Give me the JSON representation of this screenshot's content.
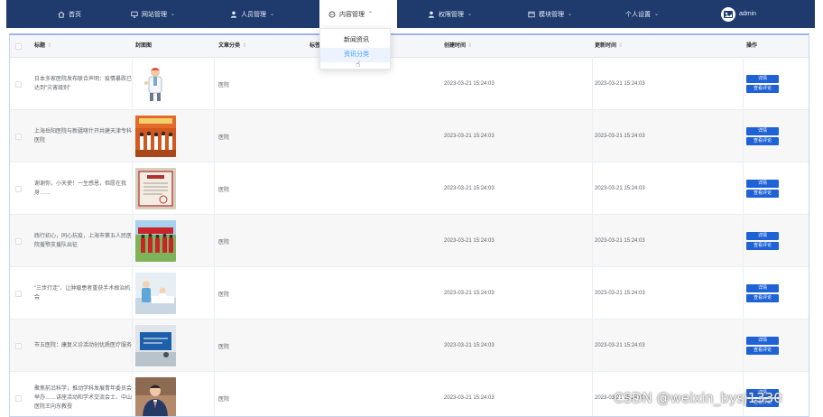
{
  "nav": {
    "items": [
      {
        "label": "首页",
        "icon": "home-icon"
      },
      {
        "label": "网站管理",
        "icon": "monitor-icon"
      },
      {
        "label": "人员管理",
        "icon": "user-icon"
      },
      {
        "label": "内容管理",
        "icon": "chat-icon",
        "active": true
      },
      {
        "label": "权限管理",
        "icon": "user-icon"
      },
      {
        "label": "模块管理",
        "icon": "window-icon"
      },
      {
        "label": "个人设置"
      }
    ],
    "user": {
      "name": "admin"
    }
  },
  "dropdown": {
    "items": [
      "新闻资讯",
      "资讯分类"
    ],
    "hovered_index": 1
  },
  "table": {
    "headers": {
      "title": "标题",
      "cover": "封面图",
      "category": "文章分类",
      "tags": "标签",
      "created": "创建时间",
      "updated": "更新时间",
      "actions": "操作"
    },
    "buttons": {
      "detail": "详情",
      "comments": "查看评论"
    },
    "rows": [
      {
        "title": "日本多家医院发布联合声明：疫情暴跌已达到\"灾害级别\"",
        "category": "医院",
        "created": "2023-03-21 15:24:03",
        "updated": "2023-03-21 15:24:03",
        "thumb": "doctor"
      },
      {
        "title": "上海岳阳医院与新疆喀什开共建天津专科医院",
        "category": "医院",
        "created": "2023-03-21 15:24:03",
        "updated": "2023-03-21 15:24:03",
        "thumb": "group"
      },
      {
        "title": "谢谢你，小天使！一生感恩，但愿在我身……",
        "category": "医院",
        "created": "2023-03-21 15:24:03",
        "updated": "2023-03-21 15:24:03",
        "thumb": "certificate"
      },
      {
        "title": "践行初心，同心抗疫，上海市第五人民医院援鄂支援队出征",
        "category": "医院",
        "created": "2023-03-21 15:24:03",
        "updated": "2023-03-21 15:24:03",
        "thumb": "banner"
      },
      {
        "title": "\"三步行走\"，让肿瘤患者重获手术根治机会",
        "category": "医院",
        "created": "2023-03-21 15:24:03",
        "updated": "2023-03-21 15:24:03",
        "thumb": "ward"
      },
      {
        "title": "市五医院：康复义诊活动创优质医疗服务",
        "category": "医院",
        "created": "2023-03-21 15:24:03",
        "updated": "2023-03-21 15:24:03",
        "thumb": "sign"
      },
      {
        "title": "聚焦前沿科学，推动学科发展青年委员会举办……讲座活动和学术交流会士、中山医院王向东教授",
        "category": "医院",
        "created": "2023-03-21 15:24:03",
        "updated": "2023-03-21 15:24:03",
        "thumb": "portrait"
      }
    ]
  },
  "watermark": "CSDN @weixin_bysj1330"
}
